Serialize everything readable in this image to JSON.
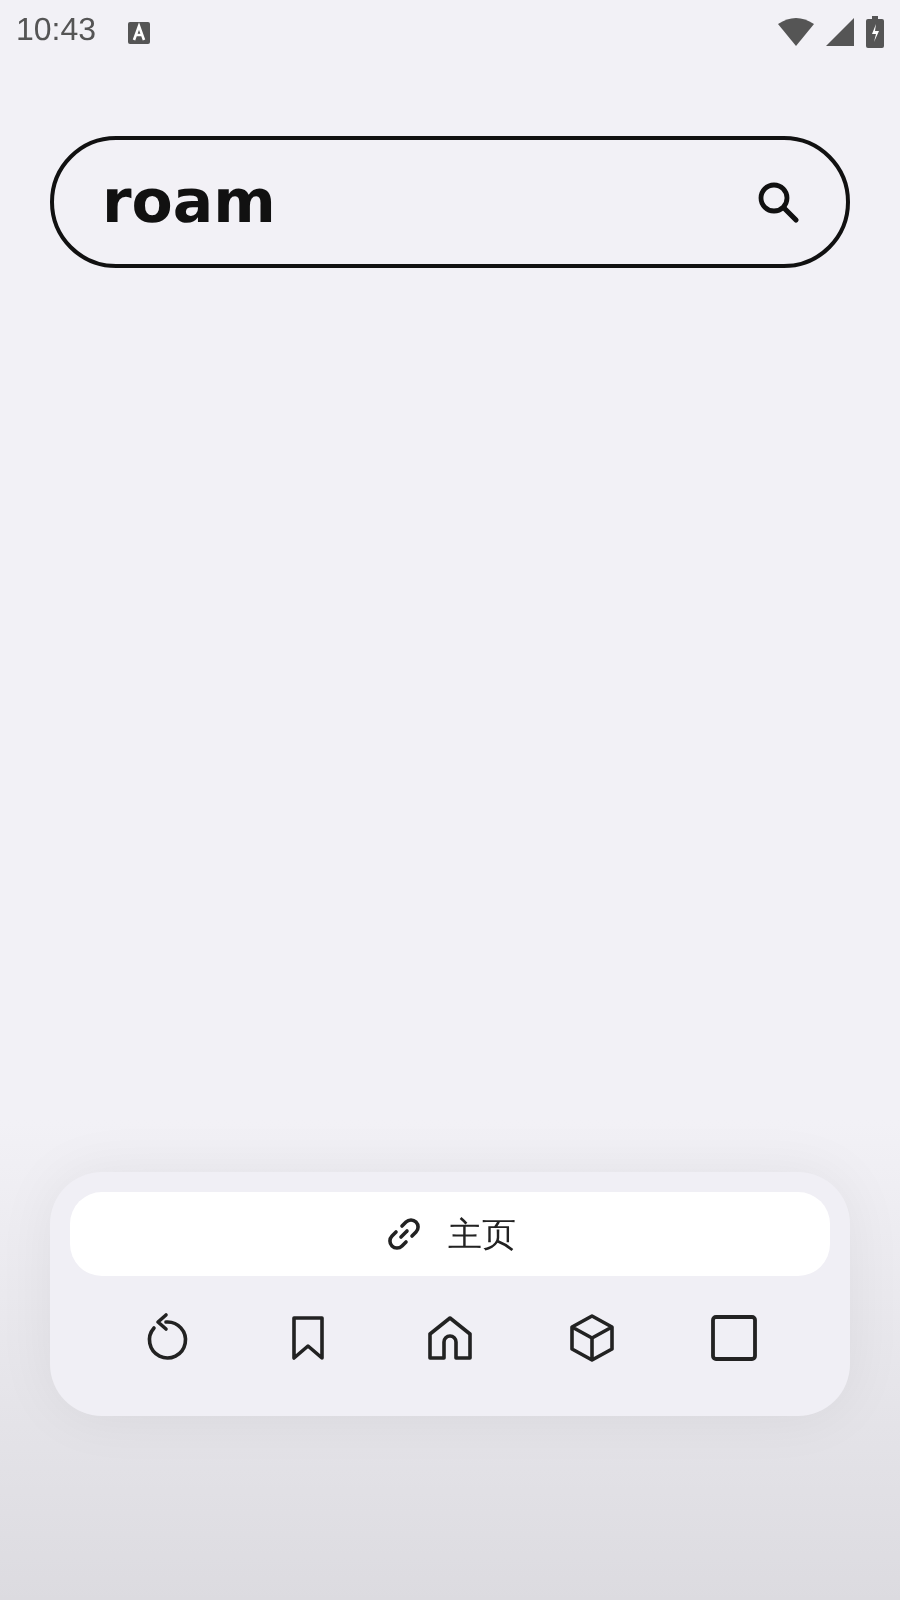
{
  "status_bar": {
    "time": "10:43"
  },
  "search": {
    "value": "roam"
  },
  "address_bar": {
    "label": "主页"
  }
}
